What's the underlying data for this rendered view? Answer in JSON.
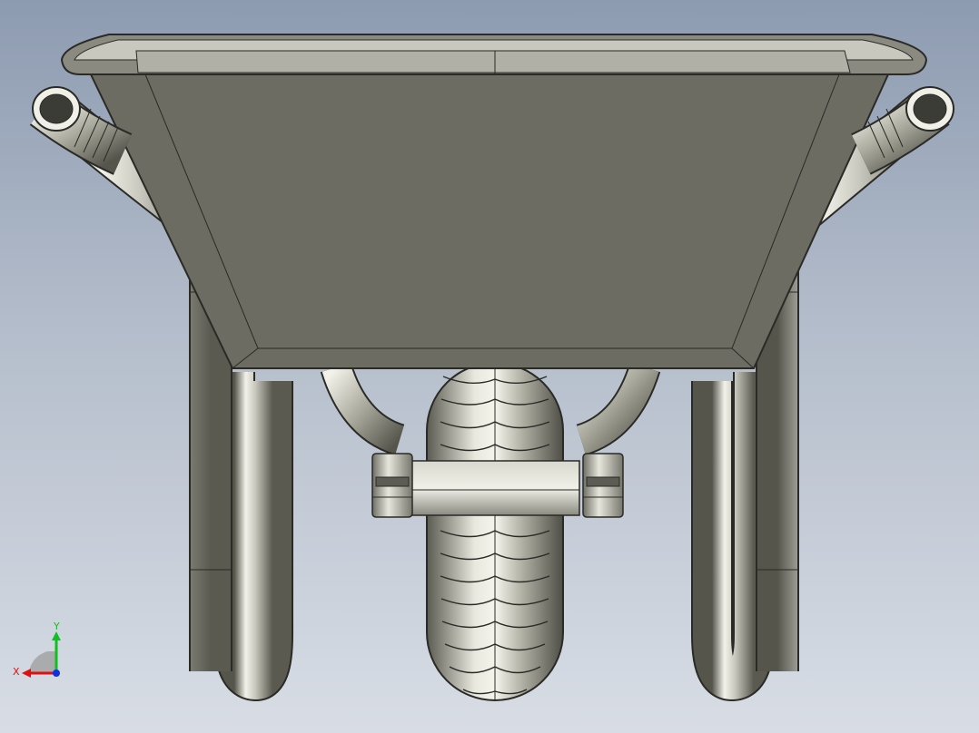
{
  "viewport": {
    "colors": {
      "background_top": "#8d9bb1",
      "background_bottom": "#d8dde5",
      "tray": "#6c6c62",
      "metal_light": "#f2f2ea",
      "metal_mid": "#a8a89c",
      "metal_dark": "#55554c",
      "edge": "#2a2a26"
    }
  },
  "triad": {
    "x_label": "X",
    "y_label": "Y",
    "x_color": "#e01010",
    "y_color": "#10c020",
    "z_color": "#1030e0"
  }
}
